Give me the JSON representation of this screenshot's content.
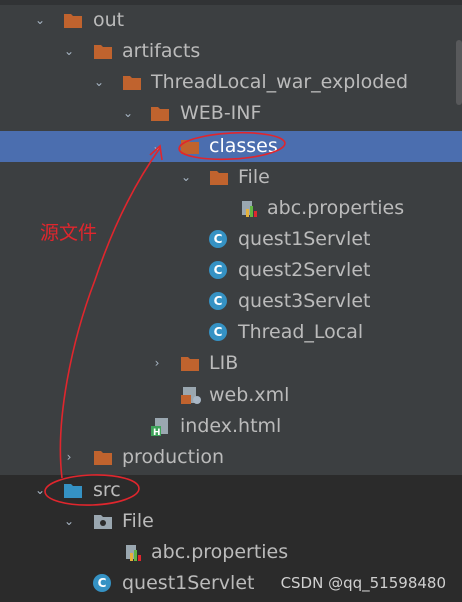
{
  "tree": {
    "rows": [
      {
        "label": "out",
        "type": "folder"
      },
      {
        "label": "artifacts",
        "type": "folder"
      },
      {
        "label": "ThreadLocal_war_exploded",
        "type": "folder"
      },
      {
        "label": "WEB-INF",
        "type": "folder"
      },
      {
        "label": "classes",
        "type": "folder",
        "selected": true
      },
      {
        "label": "File",
        "type": "folder"
      },
      {
        "label": "abc.properties",
        "type": "properties-file"
      },
      {
        "label": "quest1Servlet",
        "type": "class"
      },
      {
        "label": "quest2Servlet",
        "type": "class"
      },
      {
        "label": "quest3Servlet",
        "type": "class"
      },
      {
        "label": "Thread_Local",
        "type": "class"
      },
      {
        "label": "LIB",
        "type": "folder"
      },
      {
        "label": "web.xml",
        "type": "xml-file"
      },
      {
        "label": "index.html",
        "type": "html-file"
      },
      {
        "label": "production",
        "type": "folder"
      },
      {
        "label": "src",
        "type": "source-folder"
      },
      {
        "label": "File",
        "type": "package-folder"
      },
      {
        "label": "abc.properties",
        "type": "properties-file"
      },
      {
        "label": "quest1Servlet",
        "type": "class"
      }
    ]
  },
  "annotation": {
    "text": "源文件",
    "color": "#e0262d"
  },
  "watermark": "CSDN @qq_51598480",
  "colors": {
    "selection": "#4b6eaf",
    "folder": "#c0632e",
    "source_folder": "#3592c4",
    "class_icon": "#3592c4",
    "text": "#bbbbbb"
  }
}
